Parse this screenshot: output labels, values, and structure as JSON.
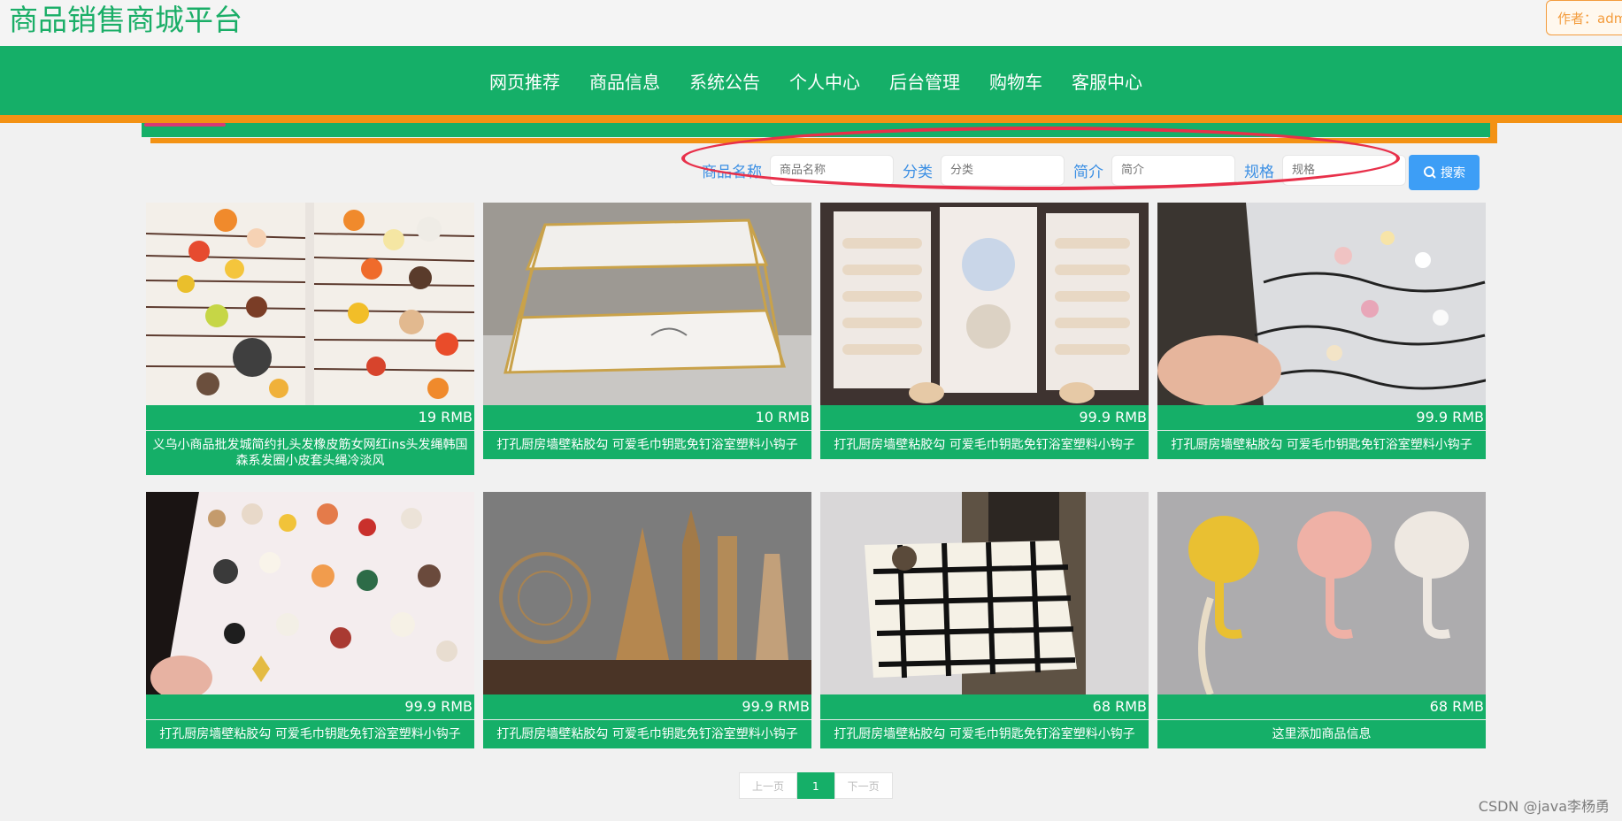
{
  "header": {
    "site_title": "商品销售商城平台",
    "author": "作者：admi"
  },
  "nav": {
    "items": [
      "网页推荐",
      "商品信息",
      "系统公告",
      "个人中心",
      "后台管理",
      "购物车",
      "客服中心"
    ]
  },
  "search": {
    "fields": [
      {
        "label": "商品名称",
        "placeholder": "商品名称"
      },
      {
        "label": "分类",
        "placeholder": "分类"
      },
      {
        "label": "简介",
        "placeholder": "简介"
      },
      {
        "label": "规格",
        "placeholder": "规格"
      }
    ],
    "button_label": "搜索"
  },
  "products": [
    {
      "price": "19 RMB",
      "name": "义乌小商品批发城简约扎头发橡皮筋女网红ins头发绳韩国森系发圈小皮套头绳冷淡风",
      "image": "hair-ties-photo"
    },
    {
      "price": "10 RMB",
      "name": "打孔厨房墙壁粘胶勾 可爱毛巾钥匙免钉浴室塑料小钩子",
      "image": "marble-tray-photo"
    },
    {
      "price": "99.9 RMB",
      "name": "打孔厨房墙壁粘胶勾 可爱毛巾钥匙免钉浴室塑料小钩子",
      "image": "pearl-hairpins-photo"
    },
    {
      "price": "99.9 RMB",
      "name": "打孔厨房墙壁粘胶勾 可爱毛巾钥匙免钉浴室塑料小钩子",
      "image": "bag-of-hairclips-photo"
    },
    {
      "price": "99.9 RMB",
      "name": "打孔厨房墙壁粘胶勾 可爱毛巾钥匙免钉浴室塑料小钩子",
      "image": "hair-clips-collection-photo"
    },
    {
      "price": "99.9 RMB",
      "name": "打孔厨房墙壁粘胶勾 可爱毛巾钥匙免钉浴室塑料小钩子",
      "image": "landmark-models-photo"
    },
    {
      "price": "68 RMB",
      "name": "打孔厨房墙壁粘胶勾 可爱毛巾钥匙免钉浴室塑料小钩子",
      "image": "tote-bag-photo"
    },
    {
      "price": "68 RMB",
      "name": "这里添加商品信息",
      "image": "wall-hooks-photo"
    }
  ],
  "pagination": {
    "prev": "上一页",
    "current": "1",
    "next": "下一页"
  },
  "watermark": "CSDN @java李杨勇",
  "colors": {
    "brand_green": "#15af68",
    "accent_orange": "#f39214",
    "search_blue": "#3d9ef6",
    "annotation_red": "#e8304a"
  }
}
